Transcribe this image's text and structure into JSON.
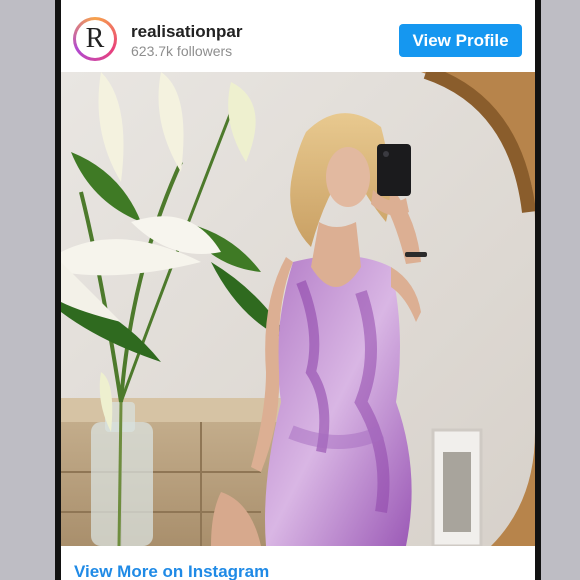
{
  "profile": {
    "username": "realisationpar",
    "followers": "623.7k followers",
    "avatar_letter": "R"
  },
  "actions": {
    "view_profile": "View Profile",
    "view_more": "View More on Instagram"
  },
  "post": {
    "image_subject": "photo",
    "dress_color": "#9b59b6"
  }
}
